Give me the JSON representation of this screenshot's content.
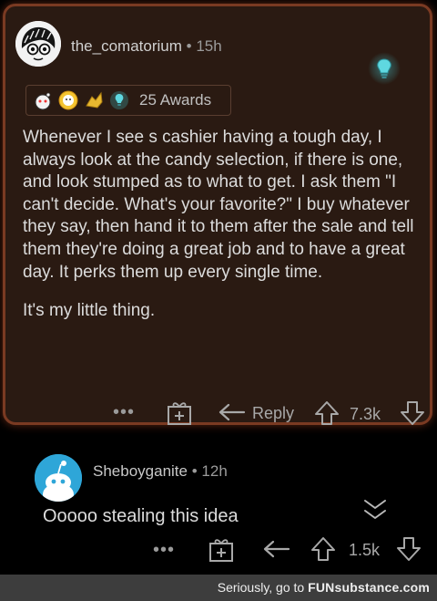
{
  "comment": {
    "username": "the_comatorium",
    "separator": "•",
    "time": "15h",
    "awards_label": "25 Awards",
    "body_paragraphs": [
      "Whenever I see s cashier having a tough day, I always look at the candy selection, if there is one, and look stumped as to what to get. I ask them \"I can't decide. What's your favorite?\" I buy whatever they say, then hand it to them after the sale and tell them they're doing a great job and to have a great day. It perks them up every single time.",
      "It's my little thing."
    ],
    "more_label": "•••",
    "reply_label": "Reply",
    "score": "7.3k"
  },
  "reply": {
    "username": "Sheboyganite",
    "separator": "•",
    "time": "12h",
    "body": "Ooooo stealing this idea",
    "more_label": "•••",
    "score": "1.5k"
  },
  "footer": {
    "prefix": "Seriously, go to ",
    "brand": "FUNsubstance.com"
  },
  "colors": {
    "highlight_border": "#7a3a22",
    "highlight_bg": "#2a1a12",
    "reply_avatar": "#2ea6d8"
  },
  "icons": [
    "avatar-icon",
    "lightbulb-award-icon",
    "award-icons",
    "gift-icon",
    "reply-arrow-icon",
    "upvote-icon",
    "downvote-icon",
    "collapse-chevron-icon",
    "snoo-avatar-icon"
  ]
}
